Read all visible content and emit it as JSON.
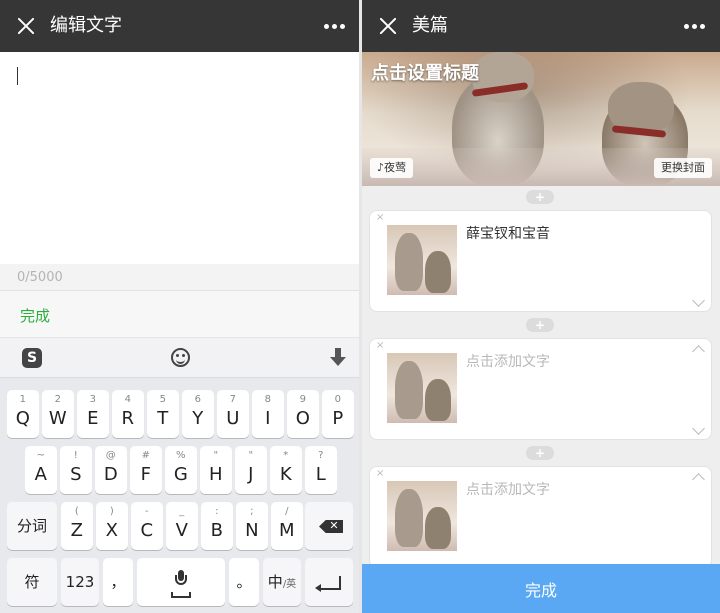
{
  "left": {
    "title": "编辑文字",
    "counter": "0/5000",
    "done_label": "完成",
    "keyboard": {
      "logo": "S",
      "row1": [
        {
          "main": "Q",
          "sub": "1"
        },
        {
          "main": "W",
          "sub": "2"
        },
        {
          "main": "E",
          "sub": "3"
        },
        {
          "main": "R",
          "sub": "4"
        },
        {
          "main": "T",
          "sub": "5"
        },
        {
          "main": "Y",
          "sub": "6"
        },
        {
          "main": "U",
          "sub": "7"
        },
        {
          "main": "I",
          "sub": "8"
        },
        {
          "main": "O",
          "sub": "9"
        },
        {
          "main": "P",
          "sub": "0"
        }
      ],
      "row2": [
        {
          "main": "A",
          "sub": "~"
        },
        {
          "main": "S",
          "sub": "!"
        },
        {
          "main": "D",
          "sub": "@"
        },
        {
          "main": "F",
          "sub": "#"
        },
        {
          "main": "G",
          "sub": "%"
        },
        {
          "main": "H",
          "sub": "\""
        },
        {
          "main": "J",
          "sub": "\""
        },
        {
          "main": "K",
          "sub": "*"
        },
        {
          "main": "L",
          "sub": "?"
        }
      ],
      "row3": [
        {
          "main": "Z",
          "sub": "("
        },
        {
          "main": "X",
          "sub": ")"
        },
        {
          "main": "C",
          "sub": "-"
        },
        {
          "main": "V",
          "sub": "_"
        },
        {
          "main": "B",
          "sub": ":"
        },
        {
          "main": "N",
          "sub": ";"
        },
        {
          "main": "M",
          "sub": "/"
        }
      ],
      "fenci": "分词",
      "fu": "符",
      "num": "123",
      "comma": "，",
      "period": "。",
      "zhong": "中",
      "ying": "/英"
    }
  },
  "right": {
    "title": "美篇",
    "cover_title": "点击设置标题",
    "music": "♪夜莺",
    "change_cover": "更换封面",
    "plus": "+",
    "cards": [
      {
        "text": "薛宝钗和宝音",
        "placeholder": false
      },
      {
        "text": "点击添加文字",
        "placeholder": true
      },
      {
        "text": "点击添加文字",
        "placeholder": true
      }
    ],
    "close_mark": "×",
    "finish_label": "完成"
  },
  "icons": {
    "close": "close-icon",
    "more": "more-icon",
    "emoji": "emoji-icon",
    "hide_keyboard": "hide-keyboard-icon",
    "backspace": "backspace-icon",
    "mic": "mic-icon",
    "enter": "enter-icon",
    "chevron_down": "chevron-down-icon",
    "chevron_up": "chevron-up-icon"
  },
  "colors": {
    "topbar": "#363636",
    "done_green": "#2bad3d",
    "finish_blue": "#5aa8f3"
  }
}
